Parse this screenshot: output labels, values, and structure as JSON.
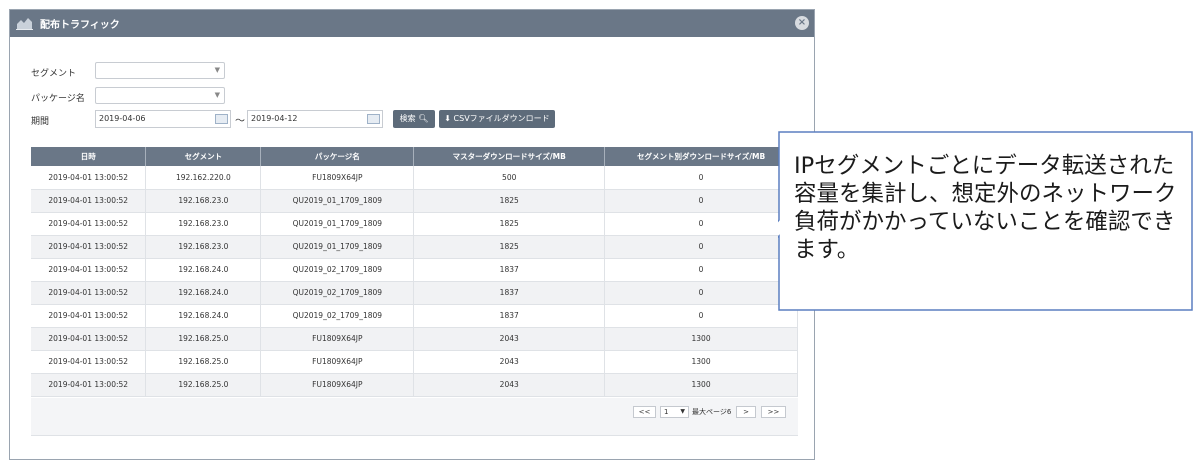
{
  "window": {
    "title": "配布トラフィック",
    "close": "×"
  },
  "form": {
    "segment_label": "セグメント",
    "package_label": "パッケージ名",
    "period_label": "期間",
    "date_from": "2019-04-06",
    "date_to": "2019-04-12",
    "tilde": "〜",
    "search_label": "検索",
    "csv_label": "CSVファイルダウンロード"
  },
  "table": {
    "headers": [
      "日時",
      "セグメント",
      "パッケージ名",
      "マスターダウンロードサイズ/MB",
      "セグメント別ダウンロードサイズ/MB"
    ],
    "rows": [
      [
        "2019-04-01 13:00:52",
        "192.162.220.0",
        "FU1809X64JP",
        "500",
        "0"
      ],
      [
        "2019-04-01 13:00:52",
        "192.168.23.0",
        "QU2019_01_1709_1809",
        "1825",
        "0"
      ],
      [
        "2019-04-01 13:00:52",
        "192.168.23.0",
        "QU2019_01_1709_1809",
        "1825",
        "0"
      ],
      [
        "2019-04-01 13:00:52",
        "192.168.23.0",
        "QU2019_01_1709_1809",
        "1825",
        "0"
      ],
      [
        "2019-04-01 13:00:52",
        "192.168.24.0",
        "QU2019_02_1709_1809",
        "1837",
        "0"
      ],
      [
        "2019-04-01 13:00:52",
        "192.168.24.0",
        "QU2019_02_1709_1809",
        "1837",
        "0"
      ],
      [
        "2019-04-01 13:00:52",
        "192.168.24.0",
        "QU2019_02_1709_1809",
        "1837",
        "0"
      ],
      [
        "2019-04-01 13:00:52",
        "192.168.25.0",
        "FU1809X64JP",
        "2043",
        "1300"
      ],
      [
        "2019-04-01 13:00:52",
        "192.168.25.0",
        "FU1809X64JP",
        "2043",
        "1300"
      ],
      [
        "2019-04-01 13:00:52",
        "192.168.25.0",
        "FU1809X64JP",
        "2043",
        "1300"
      ]
    ]
  },
  "pager": {
    "first": "<<",
    "page": "1",
    "max_pages_text": "最大ページ6",
    "next": ">",
    "last": ">>"
  },
  "callout": {
    "text": "IPセグメントごとにデータ転送された容量を集計し、想定外のネットワーク負荷がかかっていないことを確認できます。"
  }
}
